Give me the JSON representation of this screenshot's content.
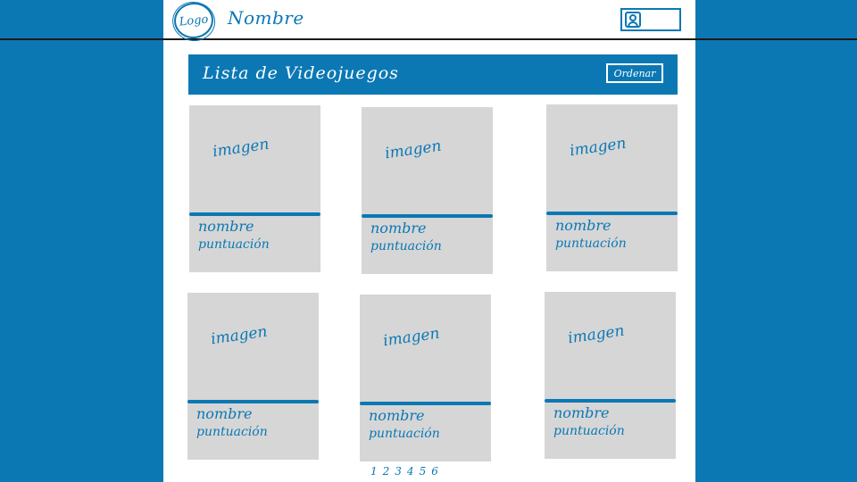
{
  "header": {
    "logo_text": "Logo",
    "site_name": "Nombre",
    "user_icon": "user-icon"
  },
  "list": {
    "title": "Lista de Videojuegos",
    "sort_label": "Ordenar"
  },
  "cards": [
    {
      "image": "imagen",
      "name": "nombre",
      "score": "puntuación"
    },
    {
      "image": "imagen",
      "name": "nombre",
      "score": "puntuación"
    },
    {
      "image": "imagen",
      "name": "nombre",
      "score": "puntuación"
    },
    {
      "image": "imagen",
      "name": "nombre",
      "score": "puntuación"
    },
    {
      "image": "imagen",
      "name": "nombre",
      "score": "puntuación"
    },
    {
      "image": "imagen",
      "name": "nombre",
      "score": "puntuación"
    }
  ],
  "pagination": [
    "1",
    "2",
    "3",
    "4",
    "5",
    "6"
  ],
  "colors": {
    "accent": "#0b78b4",
    "card_bg": "#d6d6d6",
    "page_bg": "#ffffff"
  }
}
